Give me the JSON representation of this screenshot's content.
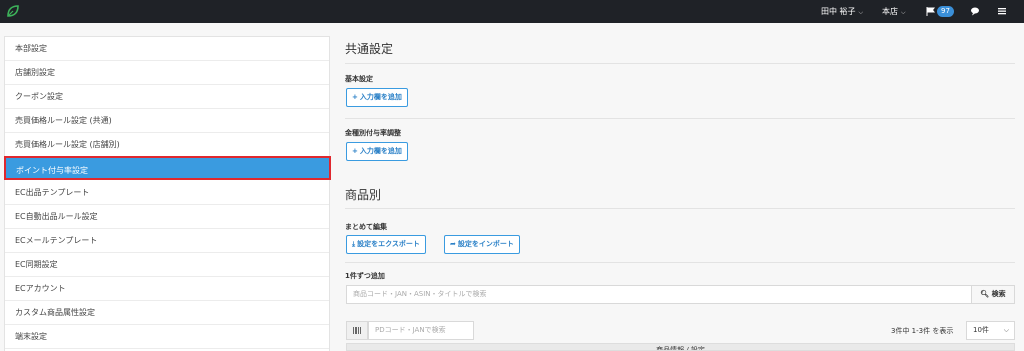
{
  "topbar": {
    "user_name": "田中 裕子",
    "store": "本店",
    "notifications": "97",
    "icons": [
      "leaf-logo-icon",
      "flag-icon",
      "chat-icon",
      "menu-icon"
    ]
  },
  "sidebar": {
    "items": [
      {
        "label": "本部設定",
        "active": false
      },
      {
        "label": "店舗別設定",
        "active": false
      },
      {
        "label": "クーポン設定",
        "active": false
      },
      {
        "label": "売買価格ルール設定 (共通)",
        "active": false
      },
      {
        "label": "売買価格ルール設定 (店舗別)",
        "active": false
      },
      {
        "label": "ポイント付与率設定",
        "active": true
      },
      {
        "label": "EC出品テンプレート",
        "active": false
      },
      {
        "label": "EC自動出品ルール設定",
        "active": false
      },
      {
        "label": "ECメールテンプレート",
        "active": false
      },
      {
        "label": "EC同期設定",
        "active": false
      },
      {
        "label": "ECアカウント",
        "active": false
      },
      {
        "label": "カスタム商品属性設定",
        "active": false
      },
      {
        "label": "端末設定",
        "active": false
      }
    ]
  },
  "main": {
    "common_title": "共通設定",
    "basic_label": "基本設定",
    "add_row_label": "入力欄を追加",
    "denomination_label": "金種別付与率調整",
    "product_title": "商品別",
    "bulk_edit_label": "まとめて編集",
    "export_label": "設定をエクスポート",
    "import_label": "設定をインポート",
    "single_add_label": "1件ずつ追加",
    "search_placeholder": "商品コード・JAN・ASIN・タイトルで検索",
    "search_button": "検索",
    "pd_placeholder": "PDコード・JANで検索",
    "count_text": "3件中 1-3件 を表示",
    "per_page": "10件",
    "table_header": "商品情報 / 設定"
  },
  "colors": {
    "accent": "#3a9be0",
    "highlight_border": "#e0282e",
    "topbar": "#1f2227"
  }
}
